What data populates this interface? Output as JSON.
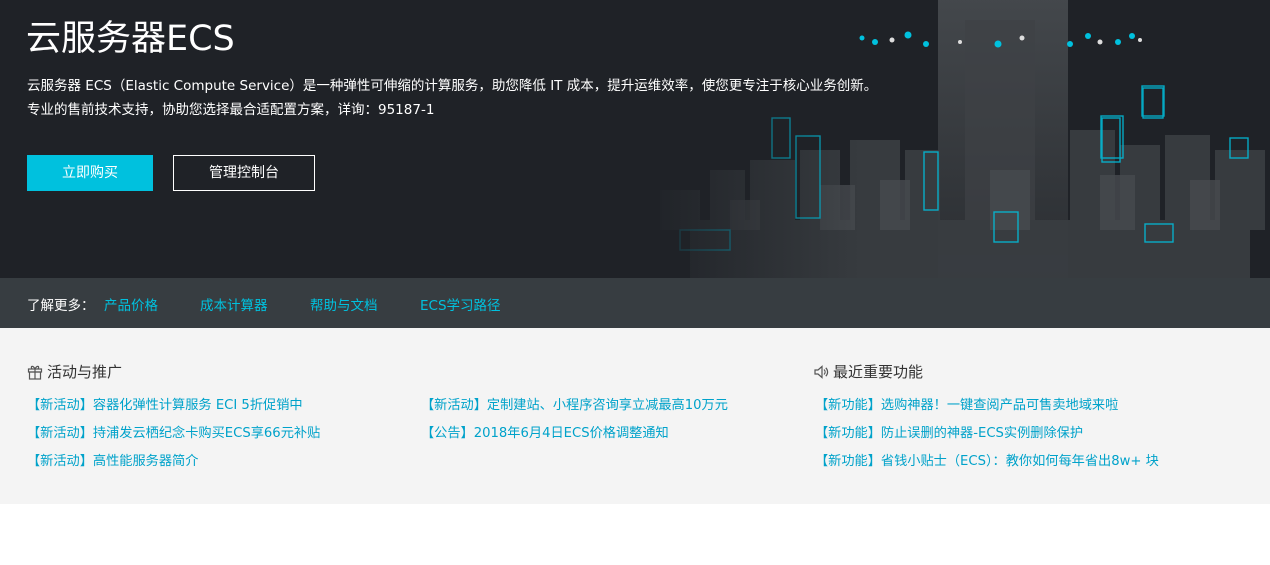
{
  "hero": {
    "title": "云服务器ECS",
    "desc_line1": "云服务器 ECS（Elastic Compute Service）是一种弹性可伸缩的计算服务，助您降低 IT 成本，提升运维效率，使您更专注于核心业务创新。",
    "desc_line2": "专业的售前技术支持，协助您选择最合适配置方案，详询：95187-1",
    "buy_label": "立即购买",
    "console_label": "管理控制台"
  },
  "learn_more": {
    "label": "了解更多：",
    "links": [
      "产品价格",
      "成本计算器",
      "帮助与文档",
      "ECS学习路径"
    ]
  },
  "promotions": {
    "title": "活动与推广",
    "icon": "gift-icon",
    "col1": [
      "【新活动】容器化弹性计算服务 ECI 5折促销中",
      "【新活动】持浦发云栖纪念卡购买ECS享66元补贴",
      "【新活动】高性能服务器简介"
    ],
    "col2": [
      "【新活动】定制建站、小程序咨询享立减最高10万元",
      "【公告】2018年6月4日ECS价格调整通知"
    ]
  },
  "features": {
    "title": "最近重要功能",
    "icon": "speaker-icon",
    "items": [
      "【新功能】选购神器！一键查阅产品可售卖地域来啦",
      "【新功能】防止误删的神器-ECS实例删除保护",
      "【新功能】省钱小贴士（ECS）：教你如何每年省出8w+ 块"
    ]
  },
  "colors": {
    "accent": "#00c1de",
    "hero_bg": "#1f2227",
    "bar_bg": "#373d41",
    "link": "#00a2ca"
  }
}
